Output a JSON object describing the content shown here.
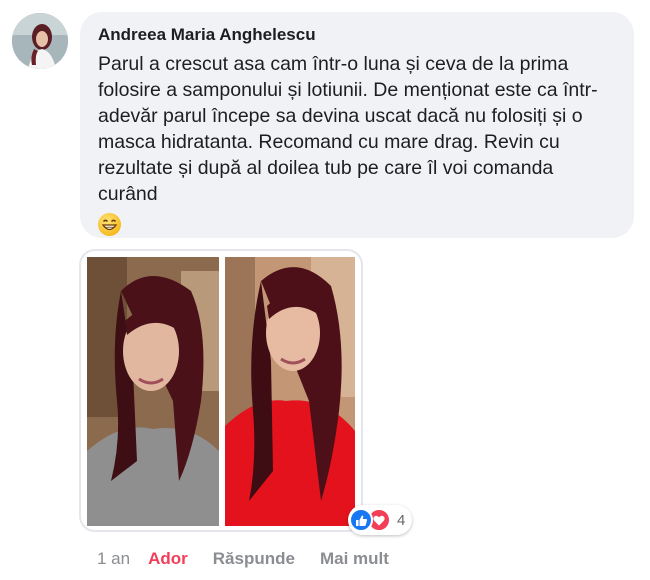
{
  "comment": {
    "author": "Andreea Maria Anghelescu",
    "text": "Parul a crescut asa cam într-o luna și ceva de la prima folosire a samponului și lotiunii. De menționat este ca într-adevăr parul începe sa devina uscat dacă nu folosiți și o masca hidratanta. Recomand cu mare drag. Revin cu rezultate și după al doilea tub pe care îl voi comanda curând",
    "emoji": "grinning-face-with-smiling-eyes"
  },
  "attachment": {
    "icon": "before-after-hair-photo"
  },
  "reactions": {
    "types": [
      "like",
      "love"
    ],
    "count": "4",
    "like_color": "#1877f2",
    "love_color": "#f33e58"
  },
  "actions": {
    "time": "1 an",
    "like_label": "Ador",
    "like_color": "#f33e58",
    "reply_label": "Răspunde",
    "more_label": "Mai mult"
  }
}
